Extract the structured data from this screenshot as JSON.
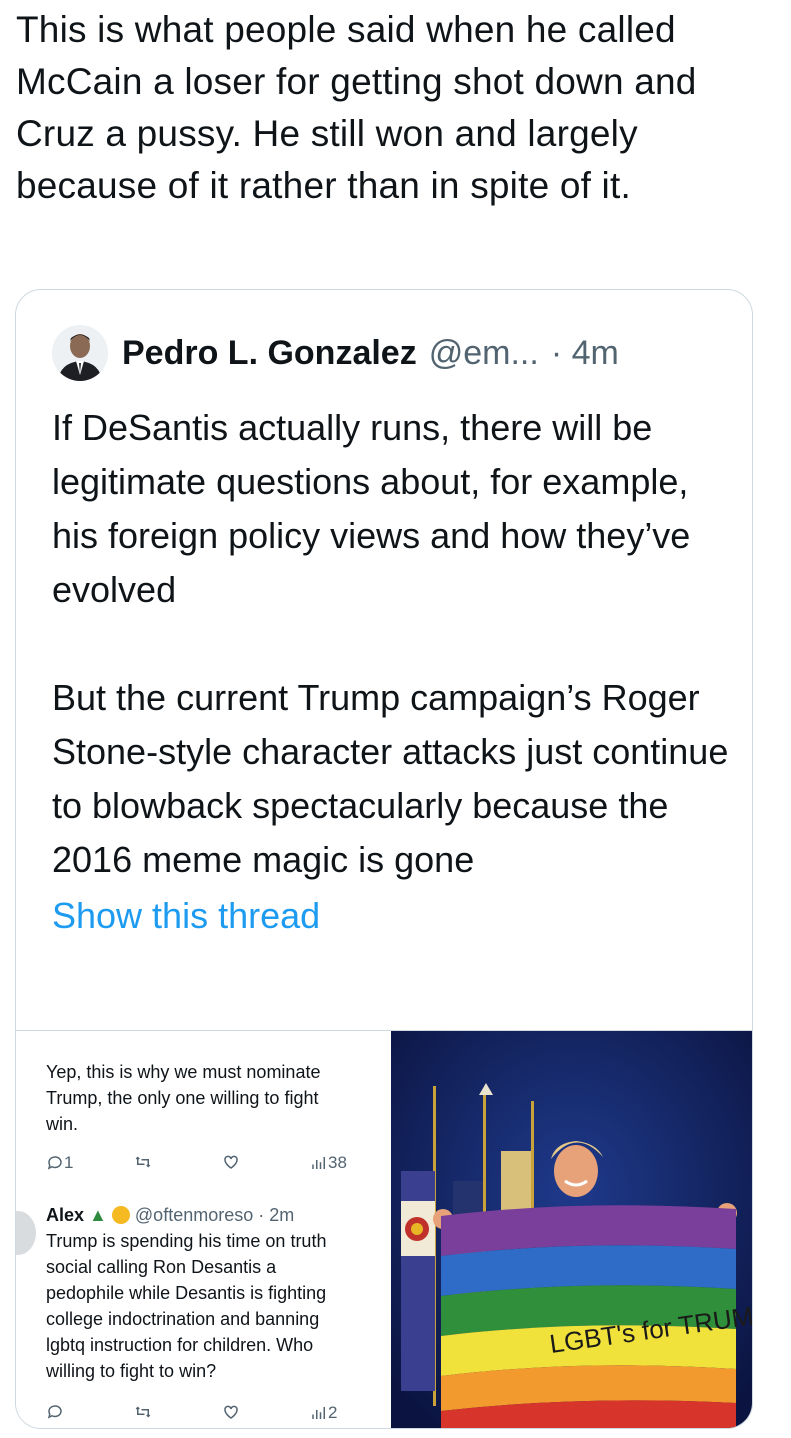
{
  "tweet": {
    "text": "This is what people said when he called McCain a loser for getting shot down and Cruz a pussy. He still won and largely because of it rather than in spite of it."
  },
  "quoted": {
    "name": "Pedro L. Gonzalez",
    "handle": "@em...",
    "time": "· 4m",
    "para1": "If DeSantis actually runs, there will be legitimate questions about, for example, his foreign policy views and how they’ve evolved",
    "para2": "But the current Trump campaign’s Roger Stone-style character attacks just continue to blowback spectacularly because the 2016 meme magic is gone",
    "show_thread": "Show this thread"
  },
  "screenshot": {
    "reply1": {
      "text_line1": "Yep, this is why we must nominate",
      "text_line2": "Trump, the only one willing to fight",
      "text_line3": "win.",
      "replies": "1",
      "views": "38"
    },
    "reply2": {
      "name": "Alex",
      "handle": "@oftenmoreso",
      "time": "· 2m",
      "line1": "Trump is spending his time on truth",
      "line2": "social calling Ron Desantis a",
      "line3": "pedophile while Desantis is fighting",
      "line4": "college indoctrination and banning",
      "line5": "lgbtq instruction for children. Who",
      "line6": "willing to fight to win?",
      "views": "2"
    },
    "photo": {
      "flag_text": "LGBT's for TRUM"
    }
  },
  "colors": {
    "link": "#1d9bf0",
    "border": "#cfd9de",
    "secondary": "#536471"
  }
}
